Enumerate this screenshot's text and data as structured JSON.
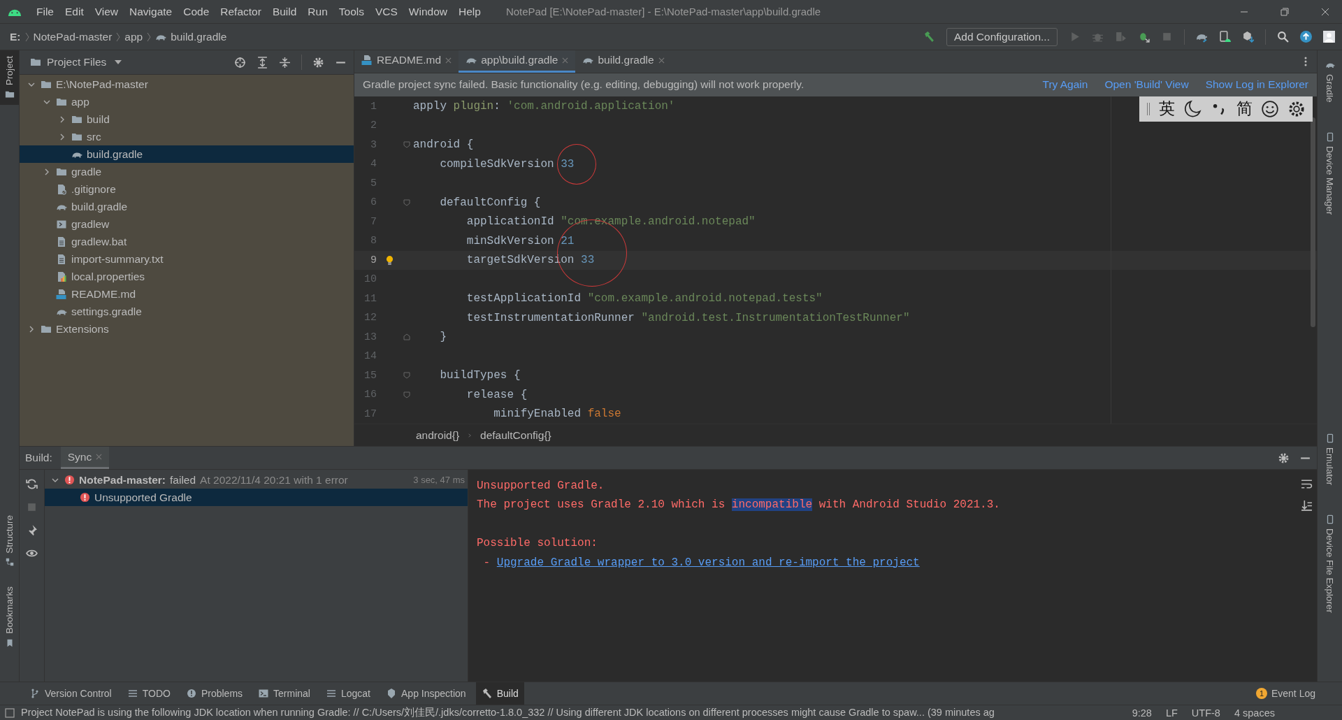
{
  "menu": [
    "File",
    "Edit",
    "View",
    "Navigate",
    "Code",
    "Refactor",
    "Build",
    "Run",
    "Tools",
    "VCS",
    "Window",
    "Help"
  ],
  "window_title": "NotePad [E:\\NotePad-master] - E:\\NotePad-master\\app\\build.gradle",
  "breadcrumb": [
    {
      "label": "E:",
      "kind": "drive"
    },
    {
      "label": "NotePad-master",
      "kind": "plain"
    },
    {
      "label": "app",
      "kind": "plain"
    },
    {
      "label": "build.gradle",
      "kind": "gradle"
    }
  ],
  "run_config": "Add Configuration...",
  "left_stripe": {
    "top": [
      {
        "label": "Project",
        "selected": true,
        "kind": "folder"
      }
    ],
    "bottom": [
      {
        "label": "Structure",
        "selected": false,
        "kind": "structure"
      },
      {
        "label": "Bookmarks",
        "selected": false,
        "kind": "bookmark"
      }
    ]
  },
  "right_stripe": {
    "top": [
      {
        "label": "Gradle",
        "kind": "gradle"
      },
      {
        "label": "Device Manager",
        "kind": "device"
      }
    ],
    "bottom": [
      {
        "label": "Emulator",
        "kind": "device"
      },
      {
        "label": "Device File Explorer",
        "kind": "device"
      }
    ]
  },
  "project_panel": {
    "title": "Project Files",
    "tree": [
      {
        "label": "E:\\NotePad-master",
        "kind": "folder",
        "expanded": true,
        "selected": false,
        "children": [
          {
            "label": "app",
            "kind": "folder",
            "expanded": true,
            "selected": false,
            "children": [
              {
                "label": "build",
                "kind": "folder",
                "expanded": false,
                "selected": false
              },
              {
                "label": "src",
                "kind": "folder",
                "expanded": false,
                "selected": false
              },
              {
                "label": "build.gradle",
                "kind": "gradle",
                "selected": true
              }
            ]
          },
          {
            "label": "gradle",
            "kind": "folder",
            "expanded": false,
            "selected": false
          },
          {
            "label": ".gitignore",
            "kind": "gitignore",
            "selected": false
          },
          {
            "label": "build.gradle",
            "kind": "gradle",
            "selected": false
          },
          {
            "label": "gradlew",
            "kind": "script",
            "selected": false
          },
          {
            "label": "gradlew.bat",
            "kind": "text",
            "selected": false
          },
          {
            "label": "import-summary.txt",
            "kind": "text",
            "selected": false
          },
          {
            "label": "local.properties",
            "kind": "properties",
            "selected": false
          },
          {
            "label": "README.md",
            "kind": "markdown",
            "selected": false
          },
          {
            "label": "settings.gradle",
            "kind": "gradle",
            "selected": false
          }
        ]
      },
      {
        "label": "Extensions",
        "kind": "folder",
        "expanded": false,
        "selected": false
      }
    ]
  },
  "tabs": [
    {
      "label": "README.md",
      "kind": "markdown",
      "selected": false
    },
    {
      "label": "app\\build.gradle",
      "kind": "gradle",
      "selected": true
    },
    {
      "label": "build.gradle",
      "kind": "gradle",
      "selected": false
    }
  ],
  "notification": {
    "message": "Gradle project sync failed. Basic functionality (e.g. editing, debugging) will not work properly.",
    "actions": [
      "Try Again",
      "Open 'Build' View",
      "Show Log in Explorer"
    ]
  },
  "ime_bar": {
    "language": "英",
    "script": "简"
  },
  "editor": {
    "lines": [
      {
        "number": "1",
        "current": false,
        "kind": "plain",
        "tokens": [
          {
            "t": "apply ",
            "kind": "plain"
          },
          {
            "t": "plugin",
            "kind": "key"
          },
          {
            "t": ": ",
            "kind": "plain"
          },
          {
            "t": "'com.android.application'",
            "kind": "str"
          }
        ]
      },
      {
        "number": "2",
        "current": false,
        "kind": "plain"
      },
      {
        "number": "3",
        "current": false,
        "kind": "fold_start",
        "tokens": [
          {
            "t": "android {",
            "kind": "plain"
          }
        ]
      },
      {
        "number": "4",
        "current": false,
        "kind": "plain",
        "tokens": [
          {
            "t": "    compileSdkVersion ",
            "kind": "plain"
          },
          {
            "t": "33",
            "kind": "num"
          }
        ]
      },
      {
        "number": "5",
        "current": false,
        "kind": "plain"
      },
      {
        "number": "6",
        "current": false,
        "kind": "fold_start",
        "tokens": [
          {
            "t": "    defaultConfig {",
            "kind": "plain"
          }
        ]
      },
      {
        "number": "7",
        "current": false,
        "kind": "plain",
        "tokens": [
          {
            "t": "        applicationId ",
            "kind": "plain"
          },
          {
            "t": "\"com.example.android.notepad\"",
            "kind": "str"
          }
        ]
      },
      {
        "number": "8",
        "current": false,
        "kind": "plain",
        "tokens": [
          {
            "t": "        minSdkVersion ",
            "kind": "plain"
          },
          {
            "t": "21",
            "kind": "num"
          }
        ]
      },
      {
        "number": "9",
        "current": true,
        "kind": "bulb",
        "tokens": [
          {
            "t": "        targetSdkVersion ",
            "kind": "plain"
          },
          {
            "t": "33",
            "kind": "num"
          }
        ]
      },
      {
        "number": "10",
        "current": false,
        "kind": "plain"
      },
      {
        "number": "11",
        "current": false,
        "kind": "plain",
        "tokens": [
          {
            "t": "        testApplicationId ",
            "kind": "plain"
          },
          {
            "t": "\"com.example.android.notepad.tests\"",
            "kind": "str"
          }
        ]
      },
      {
        "number": "12",
        "current": false,
        "kind": "plain",
        "tokens": [
          {
            "t": "        testInstrumentationRunner ",
            "kind": "plain"
          },
          {
            "t": "\"android.test.InstrumentationTestRunner\"",
            "kind": "str"
          }
        ]
      },
      {
        "number": "13",
        "current": false,
        "kind": "fold_end",
        "tokens": [
          {
            "t": "    }",
            "kind": "plain"
          }
        ]
      },
      {
        "number": "14",
        "current": false,
        "kind": "plain"
      },
      {
        "number": "15",
        "current": false,
        "kind": "fold_start",
        "tokens": [
          {
            "t": "    buildTypes {",
            "kind": "plain"
          }
        ]
      },
      {
        "number": "16",
        "current": false,
        "kind": "fold_start",
        "tokens": [
          {
            "t": "        release {",
            "kind": "plain"
          }
        ]
      },
      {
        "number": "17",
        "current": false,
        "kind": "plain",
        "tokens": [
          {
            "t": "            minifyEnabled ",
            "kind": "plain"
          },
          {
            "t": "false",
            "kind": "kw"
          }
        ]
      }
    ],
    "breadcrumb": [
      "android{}",
      "defaultConfig{}"
    ]
  },
  "build": {
    "title": "Build:",
    "tabs": [
      {
        "label": "Sync",
        "selected": true
      }
    ],
    "tree": [
      {
        "label": "NotePad-master:",
        "status": "failed",
        "detail": "At 2022/11/4 20:21 with 1 error",
        "time": "3 sec, 47 ms",
        "expanded": true,
        "selected": false,
        "children": [
          {
            "label": "Unsupported Gradle",
            "selected": true
          }
        ]
      }
    ],
    "console": [
      {
        "segments": [
          {
            "text": "Unsupported Gradle.",
            "kind": "error"
          }
        ]
      },
      {
        "segments": [
          {
            "text": "The project uses Gradle 2.10 which is ",
            "kind": "error"
          },
          {
            "text": "incompatible",
            "kind": "highlight"
          },
          {
            "text": " with Android Studio 2021.3.",
            "kind": "error"
          }
        ]
      },
      {
        "gap_before": true,
        "segments": [
          {
            "text": "Possible solution:",
            "kind": "error"
          }
        ]
      },
      {
        "segments": [
          {
            "text": " - ",
            "kind": "error"
          },
          {
            "text": "Upgrade Gradle wrapper to 3.0 version and re-import the project",
            "kind": "link"
          }
        ]
      }
    ]
  },
  "tool_windows": [
    {
      "label": "Version Control",
      "kind": "vcs",
      "selected": false
    },
    {
      "label": "TODO",
      "kind": "list",
      "selected": false
    },
    {
      "label": "Problems",
      "kind": "problems",
      "selected": false
    },
    {
      "label": "Terminal",
      "kind": "terminal",
      "selected": false
    },
    {
      "label": "Logcat",
      "kind": "list",
      "selected": false
    },
    {
      "label": "App Inspection",
      "kind": "inspect",
      "selected": false
    },
    {
      "label": "Build",
      "kind": "hammer",
      "selected": true
    }
  ],
  "event_log": {
    "label": "Event Log",
    "badge": "1"
  },
  "status_bar": {
    "message": "Project NotePad is using the following JDK location when running Gradle: // C:/Users/刘佳民/.jdks/corretto-1.8.0_332 // Using different JDK locations on different processes might cause Gradle to spaw... (39 minutes ag",
    "items": [
      "9:28",
      "LF",
      "UTF-8",
      "4 spaces"
    ]
  }
}
